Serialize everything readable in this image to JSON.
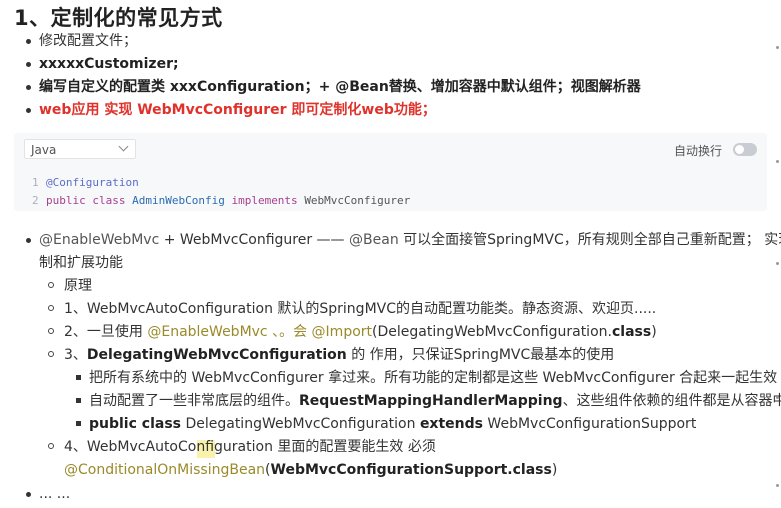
{
  "heading": "1、定制化的常见方式",
  "top_items": [
    "修改配置文件；",
    "xxxxxCustomizer;",
    "编写自定义的配置类 xxxConfiguration；+ @Bean替换、增加容器中默认组件；视图解析器",
    "web应用 实现 WebMvcConfigurer 即可定制化web功能；"
  ],
  "code_block": {
    "language": "Java",
    "wrap_label": "自动换行",
    "lines": [
      {
        "no": "1",
        "annotation": "@Configuration"
      },
      {
        "no": "2",
        "kw1": "public class",
        "cls": "AdminWebConfig",
        "kw2": "implements",
        "plain": "WebMvcConfigurer"
      }
    ]
  },
  "main_item": {
    "line1_code1": "@EnableWebMvc",
    "line1_mid": " + WebMvcConfigurer —— ",
    "line1_code2": "@Bean",
    "line1_rest": " 可以全面接管SpringMVC，所有规则全部自己重新配置； 实现定",
    "line2": "制和扩展功能"
  },
  "sub_items": [
    {
      "text": "原理"
    },
    {
      "text": "1、WebMvcAutoConfiguration  默认的SpringMVC的自动配置功能类。静态资源、欢迎页....."
    },
    {
      "prefix": "2、一旦使用 ",
      "code1": "@EnableWebMvc",
      "mid": " 、。会 ",
      "code2": "@Import",
      "rest": "(DelegatingWebMvcConfiguration.",
      "bold_end": "class",
      "close": ")"
    },
    {
      "prefix": "3、",
      "bold": "DelegatingWebMvcConfiguration",
      "rest": " 的 作用，只保证SpringMVC最基本的使用"
    }
  ],
  "sub_sub_items": [
    "把所有系统中的 WebMvcConfigurer 拿过来。所有功能的定制都是这些 WebMvcConfigurer  合起来一起生效",
    {
      "prefix": "自动配置了一些非常底层的组件。",
      "bold": "RequestMappingHandlerMapping",
      "rest": "、这些组件依赖的组件都是从容器中获取"
    },
    {
      "bold": "public class",
      "rest": " DelegatingWebMvcConfiguration ",
      "bold2": "extends",
      "rest2": " WebMvcConfigurationSupport"
    }
  ],
  "item4": {
    "line1": "4、WebMvcAutoConfiguration 里面的配置要能生效 必须",
    "code": "@ConditionalOnMissingBean",
    "open": "(",
    "bold": "WebMvcConfigurationSupport",
    "rest": ".class",
    "close": ")"
  },
  "ellipsis": "... ..."
}
